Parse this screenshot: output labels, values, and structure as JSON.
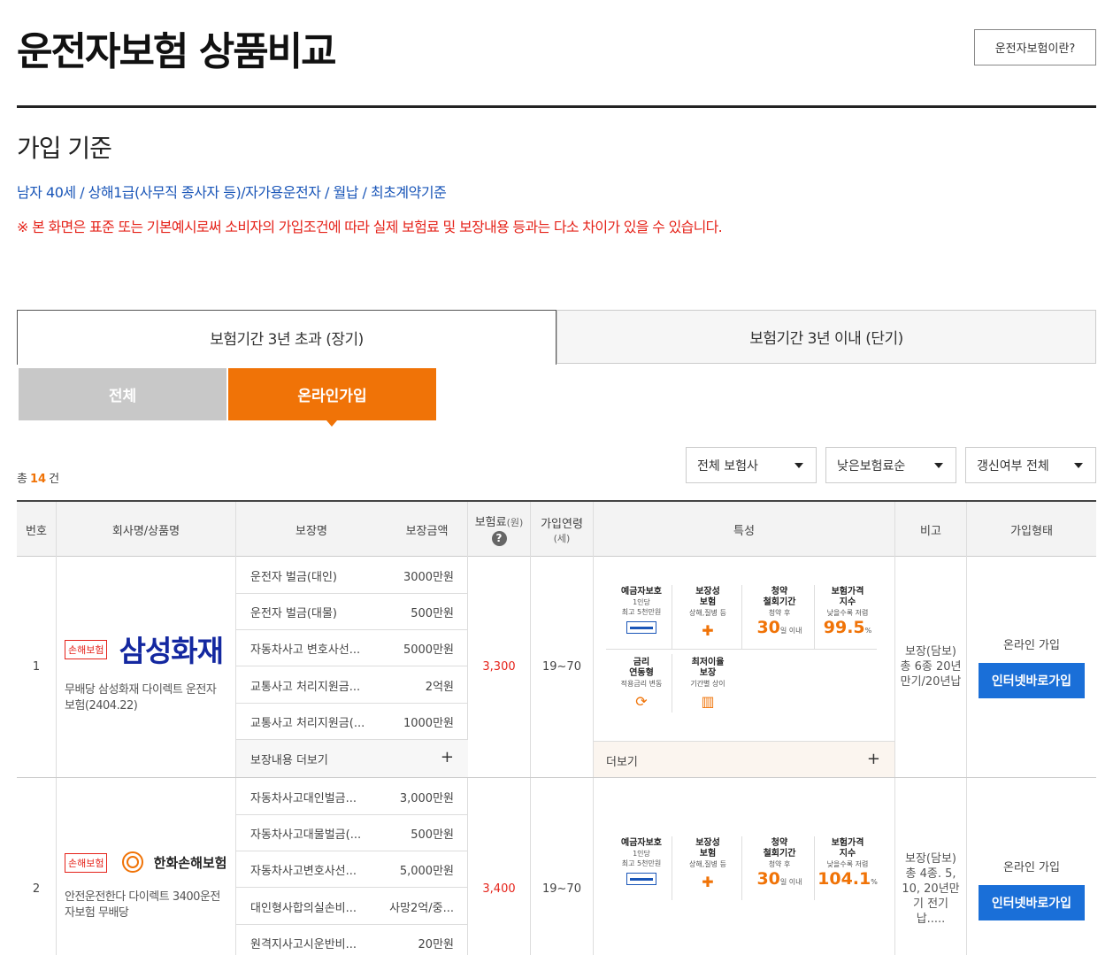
{
  "header": {
    "title": "운전자보험 상품비교",
    "info_button": "운전자보험이란?"
  },
  "criteria": {
    "title": "가입 기준",
    "text": "남자 40세 / 상해1급(사무직 종사자 등)/자가용운전자 / 월납 / 최초계약기준",
    "notice": "※ 본 화면은 표준 또는 기본예시로써 소비자의 가입조건에 따라 실제 보험료 및 보장내용 등과는 다소 차이가 있을 수 있습니다."
  },
  "tabs": {
    "long": "보험기간 3년 초과 (장기)",
    "short": "보험기간 3년 이내 (단기)",
    "active": "long"
  },
  "subtabs": {
    "all": "전체",
    "online": "온라인가입",
    "active": "online"
  },
  "list_meta": {
    "total_prefix": "총",
    "total_count": "14",
    "total_suffix": "건"
  },
  "filters": {
    "company": "전체 보험사",
    "sort": "낮은보험료순",
    "renewal": "갱신여부 전체"
  },
  "table": {
    "headers": {
      "no": "번호",
      "company": "회사명/상품명",
      "coverage": "보장명",
      "amount": "보장금액",
      "premium": "보험료",
      "premium_unit": "(원)",
      "age": "가입연령",
      "age_unit": "(세)",
      "features": "특성",
      "note": "비고",
      "join_type": "가입형태"
    },
    "rows": [
      {
        "no": "1",
        "badge": "손해보험",
        "company_logo": "삼성화재",
        "product": "무배당 삼성화재 다이렉트 운전자보험(2404.22)",
        "coverages": [
          {
            "name": "운전자 벌금(대인)",
            "amount": "3000만원"
          },
          {
            "name": "운전자 벌금(대물)",
            "amount": "500만원"
          },
          {
            "name": "자동차사고 변호사선...",
            "amount": "5000만원"
          },
          {
            "name": "교통사고 처리지원금...",
            "amount": "2억원"
          },
          {
            "name": "교통사고 처리지원금(...",
            "amount": "1000만원"
          }
        ],
        "coverage_more": "보장내용 더보기",
        "premium": "3,300",
        "age": "19~70",
        "features": {
          "deposit": {
            "t1": "예금자보호",
            "s1": "1인당",
            "s2": "최고 5천만원"
          },
          "protect": {
            "t1": "보장성",
            "t2": "보험",
            "s1": "상해,질병 등"
          },
          "withdraw": {
            "t1": "청약",
            "t2": "철회기간",
            "s1": "청약 후",
            "value": "30",
            "unit": "일 이내"
          },
          "index": {
            "t1": "보험가격",
            "t2": "지수",
            "s1": "낮을수록 저렴",
            "value": "99.5",
            "unit": "%"
          },
          "rate": {
            "t1": "금리",
            "t2": "연동형",
            "s1": "적용금리 변동"
          },
          "minrate": {
            "t1": "최저이율",
            "t2": "보장",
            "s1": "기간별 상이"
          },
          "more": "더보기"
        },
        "note": "보장(담보) 총 6종 20년만기/20년납",
        "join_type": "온라인 가입",
        "join_button": "인터넷바로가입"
      },
      {
        "no": "2",
        "badge": "손해보험",
        "company_logo": "한화손해보험",
        "product": "안전운전한다 다이렉트 3400운전자보험 무배당",
        "coverages": [
          {
            "name": "자동차사고대인벌금...",
            "amount": "3,000만원"
          },
          {
            "name": "자동차사고대물벌금(...",
            "amount": "500만원"
          },
          {
            "name": "자동차사고변호사선...",
            "amount": "5,000만원"
          },
          {
            "name": "대인형사합의실손비...",
            "amount": "사망2억/중..."
          },
          {
            "name": "원격지사고시운반비...",
            "amount": "20만원"
          }
        ],
        "premium": "3,400",
        "age": "19~70",
        "features": {
          "deposit": {
            "t1": "예금자보호",
            "s1": "1인당",
            "s2": "최고 5천만원"
          },
          "protect": {
            "t1": "보장성",
            "t2": "보험",
            "s1": "상해,질병 등"
          },
          "withdraw": {
            "t1": "청약",
            "t2": "철회기간",
            "s1": "청약 후",
            "value": "30",
            "unit": "일 이내"
          },
          "index": {
            "t1": "보험가격",
            "t2": "지수",
            "s1": "낮을수록 저렴",
            "value": "104.1",
            "unit": "%"
          }
        },
        "note": "보장(담보) 총 4종. 5, 10, 20년만기 전기납.....",
        "join_type": "온라인 가입",
        "join_button": "인터넷바로가입"
      }
    ]
  },
  "colors": {
    "accent_orange": "#f07307",
    "link_blue": "#1a56b8",
    "notice_red": "#e5231a",
    "button_blue": "#1a6fd8",
    "samsung_blue": "#1428a0"
  }
}
